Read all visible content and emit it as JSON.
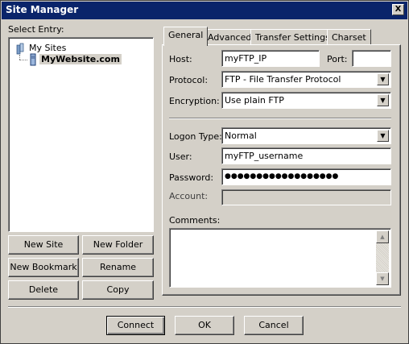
{
  "window": {
    "title": "Site Manager",
    "close_glyph": "X"
  },
  "select_entry_label": "Select Entry:",
  "tree": {
    "root_label": "My Sites",
    "child_label": "MyWebsite.com"
  },
  "left_buttons": {
    "new_site": "New Site",
    "new_folder": "New Folder",
    "new_bookmark": "New Bookmark",
    "rename": "Rename",
    "delete": "Delete",
    "copy": "Copy"
  },
  "tabs": [
    "General",
    "Advanced",
    "Transfer Settings",
    "Charset"
  ],
  "general": {
    "host_label": "Host:",
    "host_value": "myFTP_IP",
    "port_label": "Port:",
    "port_value": "",
    "protocol_label": "Protocol:",
    "protocol_value": "FTP - File Transfer Protocol",
    "encryption_label": "Encryption:",
    "encryption_value": "Use plain FTP",
    "logon_type_label": "Logon Type:",
    "logon_type_value": "Normal",
    "user_label": "User:",
    "user_value": "myFTP_username",
    "password_label": "Password:",
    "password_value": "●●●●●●●●●●●●●●●●●●",
    "account_label": "Account:",
    "account_value": "",
    "comments_label": "Comments:",
    "comments_value": ""
  },
  "bottom_buttons": {
    "connect": "Connect",
    "ok": "OK",
    "cancel": "Cancel"
  },
  "colors": {
    "titlebar": "#0a246a",
    "face": "#d4d0c8",
    "selection_bg": "#d4d0c8"
  },
  "icons": {
    "folder": "folder-icon",
    "server": "server-icon",
    "dropdown": "chevron-down-icon"
  }
}
